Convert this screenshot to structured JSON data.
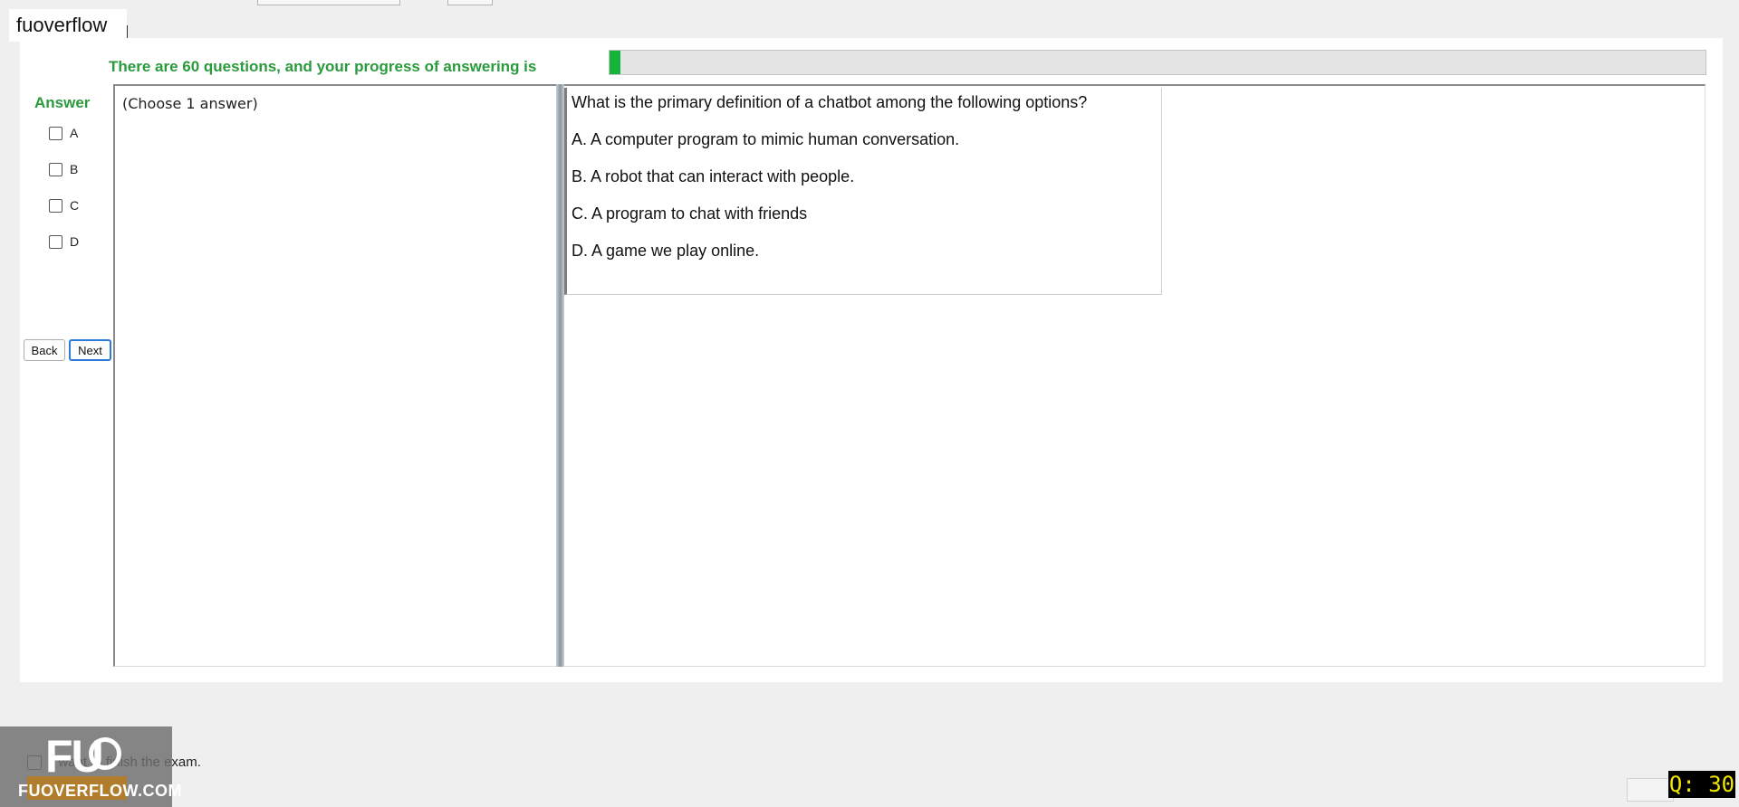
{
  "brand": {
    "label": "fuoverflow"
  },
  "progress": {
    "label": "There are 60 questions, and your progress of answering is",
    "fraction": 0.01
  },
  "answer_panel": {
    "title": "Answer",
    "options": [
      "A",
      "B",
      "C",
      "D"
    ],
    "back_label": "Back",
    "next_label": "Next"
  },
  "choose": {
    "instruction": "(Choose 1 answer)"
  },
  "question": {
    "text": "What is the primary definition of a chatbot among the following options?",
    "options": [
      "A.  A computer program to mimic human conversation.",
      "B.  A robot that can interact with people.",
      "C.  A program to chat with friends",
      "D.  A game we play online."
    ]
  },
  "finish": {
    "label": "I want to finish the exam."
  },
  "watermark": {
    "logo": "FUO",
    "site": "FUOVERFLOW.COM"
  },
  "counter": {
    "label": "Q: 30"
  },
  "colors": {
    "accent_green": "#2a9a3c",
    "progress_fill": "#14b43c",
    "counter_bg": "#000000",
    "counter_text": "#f2e600"
  }
}
